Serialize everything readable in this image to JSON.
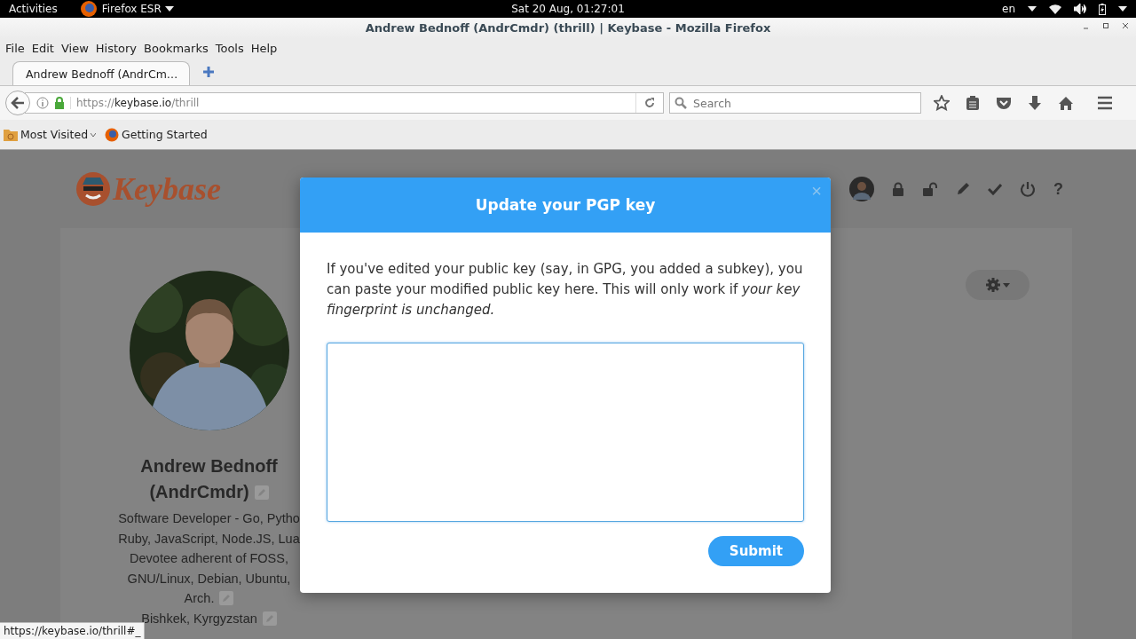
{
  "system_bar": {
    "activities": "Activities",
    "app": "Firefox ESR",
    "clock": "Sat 20 Aug, 01:27:01",
    "language": "en"
  },
  "window": {
    "title": "Andrew Bednoff (AndrCmdr) (thrill) | Keybase - Mozilla Firefox"
  },
  "menu": [
    "File",
    "Edit",
    "View",
    "History",
    "Bookmarks",
    "Tools",
    "Help"
  ],
  "tabs": [
    {
      "label": "Andrew Bednoff (AndrCm…",
      "selected": true
    }
  ],
  "address_bar": {
    "scheme": "https://",
    "host": "keybase.io",
    "path": "/thrill"
  },
  "search": {
    "placeholder": "Search"
  },
  "bookmarks": [
    "Most Visited",
    "Getting Started"
  ],
  "page": {
    "logo": "Keybase",
    "help": "?",
    "profile": {
      "name": "Andrew Bednoff",
      "username": "(AndrCmdr)",
      "bio_lines": [
        {
          "text": "Software Developer - Go, Pytho",
          "editable": false
        },
        {
          "text": "Ruby, JavaScript, Node.JS, Lua",
          "editable": false
        },
        {
          "text": "Devotee adherent of FOSS,",
          "editable": false
        },
        {
          "text": "GNU/Linux, Debian, Ubuntu,",
          "editable": false
        },
        {
          "text": "Arch.",
          "editable": true
        },
        {
          "text": "Bishkek, Kyrgyzstan",
          "editable": true
        }
      ]
    }
  },
  "modal": {
    "title": "Update your PGP key",
    "close": "×",
    "message": "If you've edited your public key (say, in GPG, you added a subkey), you can paste your modified public key here. This will only work if *your key fingerprint is unchanged.*",
    "key_field": {
      "focused": true
    },
    "submit": "Submit"
  },
  "status_tip": "https://keybase.io/thrill#_"
}
